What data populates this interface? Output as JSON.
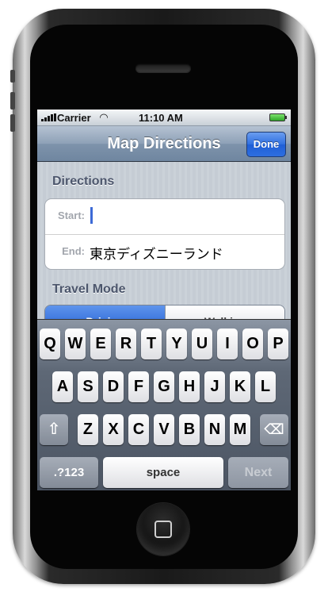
{
  "status_bar": {
    "carrier": "Carrier",
    "time": "11:10 AM",
    "wifi_icon": "wifi-icon",
    "battery_icon": "battery-icon",
    "signal_icon": "signal-bars-icon"
  },
  "nav": {
    "title": "Map Directions",
    "done_label": "Done"
  },
  "directions": {
    "section_label": "Directions",
    "start_label": "Start:",
    "start_value": "",
    "end_label": "End:",
    "end_value": "東京ディズニーランド"
  },
  "travel": {
    "section_label": "Travel Mode",
    "options": [
      "Driving",
      "Walking"
    ],
    "selected": "Driving"
  },
  "keyboard": {
    "row1": [
      "Q",
      "W",
      "E",
      "R",
      "T",
      "Y",
      "U",
      "I",
      "O",
      "P"
    ],
    "row2": [
      "A",
      "S",
      "D",
      "F",
      "G",
      "H",
      "J",
      "K",
      "L"
    ],
    "row3": [
      "Z",
      "X",
      "C",
      "V",
      "B",
      "N",
      "M"
    ],
    "shift_icon": "shift-arrow-icon",
    "delete_icon": "delete-backspace-icon",
    "numbers_label": ".?123",
    "space_label": "space",
    "next_label": "Next"
  },
  "colors": {
    "accent": "#2f6fe0",
    "nav": "#7e93ab"
  }
}
